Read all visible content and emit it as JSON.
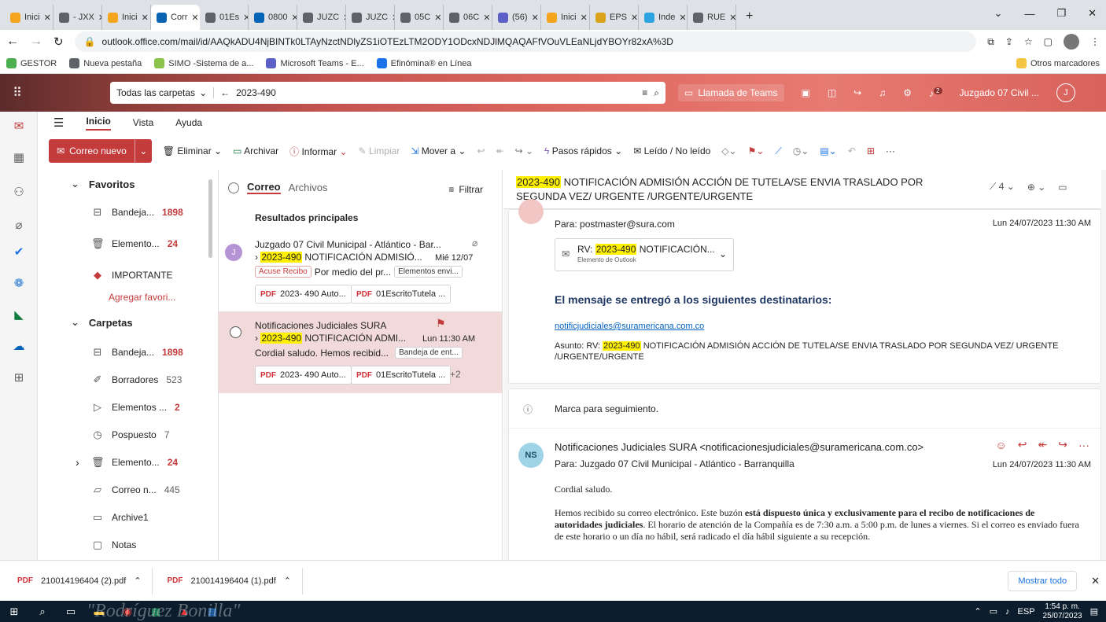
{
  "browser": {
    "tabs": [
      {
        "label": "Inici",
        "color": "#f4a41d"
      },
      {
        "label": "- JXX",
        "color": "#5f6368"
      },
      {
        "label": "Inici",
        "color": "#f4a41d"
      },
      {
        "label": "Corr",
        "color": "#0a64b2",
        "active": true
      },
      {
        "label": "01Es",
        "color": "#5f6368"
      },
      {
        "label": "0800",
        "color": "#0364b8"
      },
      {
        "label": "JUZC",
        "color": "#5f6368"
      },
      {
        "label": "JUZC",
        "color": "#5f6368"
      },
      {
        "label": "05C",
        "color": "#5f6368"
      },
      {
        "label": "06C",
        "color": "#5f6368"
      },
      {
        "label": "(56)",
        "color": "#5b5fc7"
      },
      {
        "label": "Inici",
        "color": "#f4a41d"
      },
      {
        "label": "EPS",
        "color": "#d8a31a"
      },
      {
        "label": "Inde",
        "color": "#2ca4e0"
      },
      {
        "label": "RUE",
        "color": "#5f6368"
      }
    ],
    "url": "outlook.office.com/mail/id/AAQkADU4NjBINTk0LTAyNzctNDlyZS1iOTEzLTM2ODY1ODcxNDJlMQAQAFfVOuVLEaNLjdYBOYr82xA%3D",
    "bookmarks": [
      "GESTOR",
      "Nueva pestaña",
      "SIMO -Sistema de a...",
      "Microsoft Teams - E...",
      "Efinómina® en Línea"
    ],
    "other_bookmarks": "Otros marcadores"
  },
  "outlook": {
    "search_scope": "Todas las carpetas",
    "search_query": "2023-490",
    "teams_call": "Llamada de Teams",
    "account": "Juzgado 07 Civil ...",
    "avatar_initial": "J",
    "notif_count": "2",
    "ribbon_tabs": [
      "Inicio",
      "Vista",
      "Ayuda"
    ],
    "commands": {
      "new_mail": "Correo nuevo",
      "delete": "Eliminar",
      "archive": "Archivar",
      "report": "Informar",
      "clean": "Limpiar",
      "move": "Mover a",
      "quick_steps": "Pasos rápidos",
      "read_unread": "Leído / No leído"
    }
  },
  "folders": {
    "favorites_label": "Favoritos",
    "favorites": [
      {
        "name": "Bandeja...",
        "count": "1898"
      },
      {
        "name": "Elemento...",
        "count": "24"
      },
      {
        "name": "IMPORTANTE",
        "count": ""
      }
    ],
    "add_favorite": "Agregar favori...",
    "folders_label": "Carpetas",
    "folders": [
      {
        "name": "Bandeja...",
        "count": "1898",
        "bold": true
      },
      {
        "name": "Borradores",
        "count": "523"
      },
      {
        "name": "Elementos ...",
        "count": "2",
        "bold": true
      },
      {
        "name": "Pospuesto",
        "count": "7"
      },
      {
        "name": "Elemento...",
        "count": "24",
        "bold": true
      },
      {
        "name": "Correo n...",
        "count": "445"
      },
      {
        "name": "Archive1",
        "count": ""
      },
      {
        "name": "Notas",
        "count": ""
      }
    ]
  },
  "list": {
    "tab_mail": "Correo",
    "tab_files": "Archivos",
    "filter": "Filtrar",
    "section": "Resultados principales",
    "items": [
      {
        "sender": "Juzgado 07 Civil Municipal - Atlántico - Bar...",
        "avatar": "J",
        "subject_hl": "2023-490",
        "subject": " NOTIFICACIÓN ADMISIÓ...",
        "date": "Mié 12/07",
        "tag": "Acuse Recibo",
        "preview": "Por medio del pr...",
        "folder": "Elementos envi...",
        "attachments": [
          "2023- 490 Auto...",
          "01EscritoTutela ..."
        ]
      },
      {
        "sender": "Notificaciones Judiciales SURA",
        "subject_hl": "2023-490",
        "subject": " NOTIFICACIÓN ADMI...",
        "date": "Lun 11:30 AM",
        "preview": "Cordial saludo. Hemos recibid...",
        "folder": "Bandeja de ent...",
        "attachments": [
          "2023- 490 Auto...",
          "01EscritoTutela ..."
        ],
        "more": "+2"
      }
    ]
  },
  "reading": {
    "subject_hl": "2023-490",
    "subject_line1": " NOTIFICACIÓN ADMISIÓN ACCIÓN DE TUTELA/SE ENVIA TRASLADO POR",
    "subject_line2": "SEGUNDA VEZ/ URGENTE /URGENTE/URGENTE",
    "count": "4",
    "msg1": {
      "to": "Para: postmaster@sura.com",
      "date": "Lun 24/07/2023 11:30 AM",
      "att_prefix": "RV: ",
      "att_hl": "2023-490",
      "att_rest": " NOTIFICACIÓN...",
      "att_type": "Elemento de Outlook",
      "delivered": "El mensaje se entregó a los siguientes destinatarios:",
      "recipient": "notificjudiciales@suramericana.com.co",
      "asunto_prefix": "Asunto: RV: ",
      "asunto_hl": "2023-490",
      "asunto_rest": " NOTIFICACIÓN ADMISIÓN ACCIÓN DE TUTELA/SE ENVIA TRASLADO POR SEGUNDA VEZ/ URGENTE",
      "asunto_line2": "/URGENTE/URGENTE"
    },
    "flag_note": "Marca para seguimiento.",
    "msg2": {
      "avatar": "NS",
      "from": "Notificaciones Judiciales SURA <notificacionesjudiciales@suramericana.com.co>",
      "to": "Para: Juzgado 07 Civil Municipal - Atlántico - Barranquilla",
      "date": "Lun 24/07/2023 11:30 AM",
      "greeting": "Cordial saludo.",
      "body_a": "Hemos recibido su correo electrónico. Este buzón ",
      "body_b": "está dispuesto única y exclusivamente para el recibo de notificaciones de autoridades judiciales",
      "body_c": ". El horario de atención de la Compañía es de 7:30 a.m. a 5:00 p.m. de lunes a viernes. Si el correo es enviado fuera de este horario o un día no hábil, será radicado el día hábil siguiente a su recepción."
    }
  },
  "downloads": {
    "files": [
      "210014196404 (2).pdf",
      "210014196404 (1).pdf"
    ],
    "show_all": "Mostrar todo"
  },
  "taskbar": {
    "lang": "ESP",
    "time": "1:54 p. m.",
    "date": "25/07/2023",
    "watermark": "\"Rodríguez Bonilla\""
  }
}
